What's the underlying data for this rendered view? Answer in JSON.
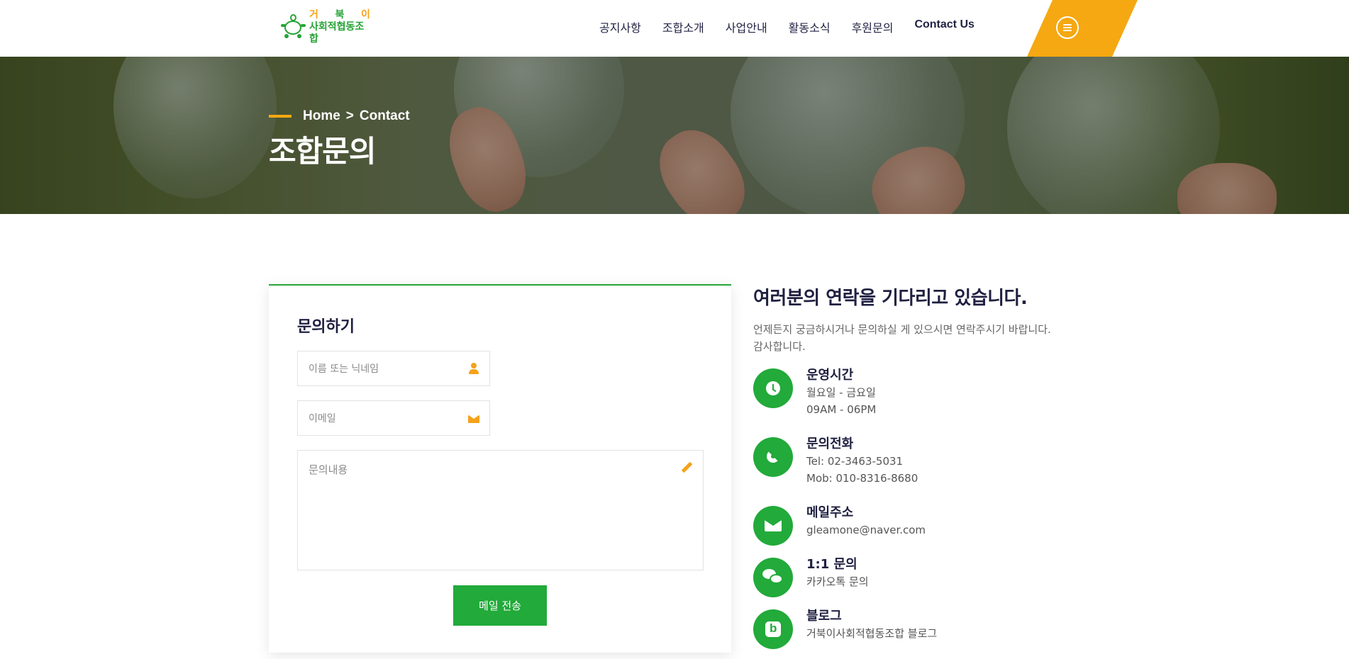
{
  "header": {
    "logo": {
      "top_chars": [
        "거",
        "북",
        "이"
      ],
      "bottom_text": "사회적협동조합"
    },
    "nav": [
      {
        "label": "공지사항"
      },
      {
        "label": "조합소개"
      },
      {
        "label": "사업안내"
      },
      {
        "label": "활동소식"
      },
      {
        "label": "후원문의"
      },
      {
        "label": "Contact Us"
      }
    ],
    "menu_icon": "hamburger-icon"
  },
  "hero": {
    "breadcrumb_home": "Home",
    "breadcrumb_sep": ">",
    "breadcrumb_current": "Contact",
    "title": "조합문의"
  },
  "form": {
    "title": "문의하기",
    "name_placeholder": "이름 또는 닉네임",
    "email_placeholder": "이메일",
    "message_placeholder": "문의내용",
    "submit_label": "메일 전송"
  },
  "contact": {
    "title": "여러분의 연락을 기다리고 있습니다.",
    "desc_line1": "언제든지 궁금하시거나 문의하실 게 있으시면 연락주시기 바랍니다.",
    "desc_line2": "감사합니다.",
    "items": [
      {
        "icon": "clock-icon",
        "label": "운영시간",
        "values": [
          "월요일 - 금요일",
          "09AM - 06PM"
        ]
      },
      {
        "icon": "phone-icon",
        "label": "문의전화",
        "values": [
          "Tel: 02-3463-5031",
          "Mob: 010-8316-8680"
        ]
      },
      {
        "icon": "envelope-icon",
        "label": "메일주소",
        "values": [
          "gleamone@naver.com"
        ]
      },
      {
        "icon": "chat-icon",
        "label": "1:1 문의",
        "values": [
          "카카오톡 문의"
        ]
      },
      {
        "icon": "blog-icon",
        "label": "블로그",
        "values": [
          "거북이사회적협동조합 블로그"
        ]
      }
    ]
  },
  "colors": {
    "accent_green": "#22aa3a",
    "accent_orange": "#f5a812",
    "text_dark": "#1f2040"
  }
}
